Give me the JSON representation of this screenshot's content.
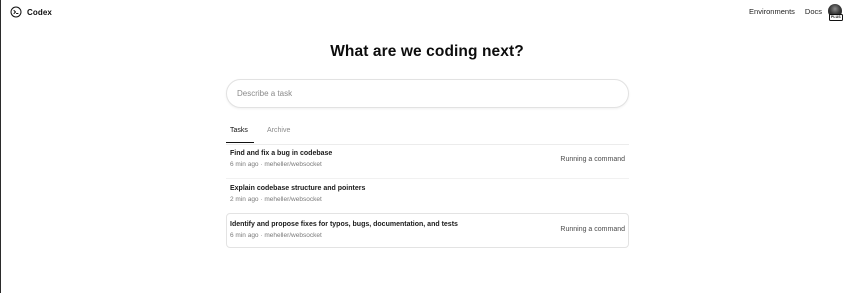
{
  "header": {
    "brand": "Codex",
    "brand_icon": "terminal-icon",
    "links": [
      {
        "label": "Environments"
      },
      {
        "label": "Docs"
      }
    ],
    "avatar_badge": "PLUS"
  },
  "main": {
    "headline": "What are we coding next?",
    "task_input": {
      "placeholder": "Describe a task",
      "value": ""
    },
    "tabs": [
      {
        "label": "Tasks",
        "active": true
      },
      {
        "label": "Archive",
        "active": false
      }
    ],
    "tasks": [
      {
        "title": "Find and fix a bug in codebase",
        "meta": "6 min ago · meheller/websocket",
        "status": "Running a command"
      },
      {
        "title": "Explain codebase structure and pointers",
        "meta": "2 min ago · meheller/websocket",
        "status": ""
      },
      {
        "title": "Identify and propose fixes for typos, bugs, documentation, and tests",
        "meta": "6 min ago · meheller/websocket",
        "status": "Running a command"
      }
    ]
  },
  "colors": {
    "text": "#0d0d0d",
    "muted": "#7a7a7a",
    "border": "#e2e2e2",
    "background": "#ffffff"
  }
}
